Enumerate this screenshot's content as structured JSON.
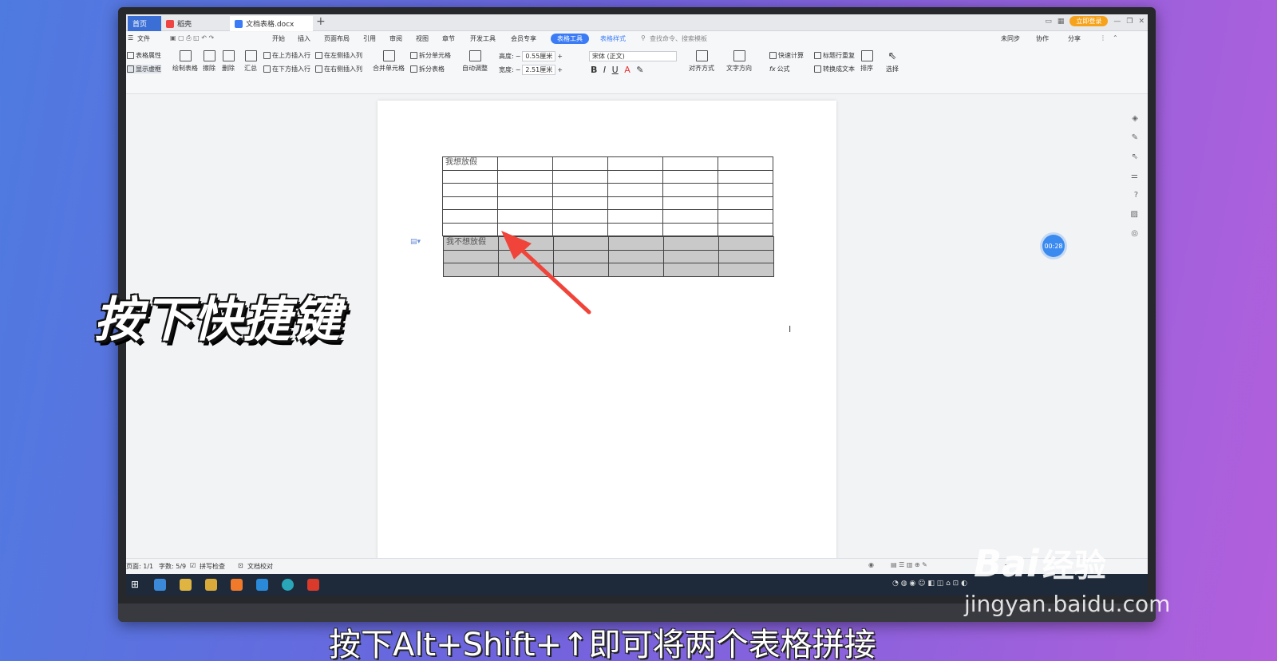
{
  "tabs": [
    {
      "label": "首页"
    },
    {
      "label": "稻壳"
    },
    {
      "label": "文档表格.docx"
    }
  ],
  "window": {
    "login_label": "立即登录",
    "new_tab": "+"
  },
  "menu": {
    "file": "文件",
    "items": [
      "开始",
      "插入",
      "页面布局",
      "引用",
      "审阅",
      "视图",
      "章节",
      "开发工具",
      "会员专享"
    ],
    "active": "表格工具",
    "table_style": "表格样式",
    "search": "查找命令、搜索模板",
    "sync": "未同步",
    "collab": "协作",
    "share": "分享"
  },
  "ribbon": {
    "table_props": "表格属性",
    "show_gridlines": "显示虚框",
    "draw_table": "绘制表格",
    "erase": "擦除",
    "delete": "删除",
    "summary": "汇总",
    "insert_above": "在上方插入行",
    "insert_below": "在下方插入行",
    "insert_left": "在左侧插入列",
    "insert_right": "在右侧插入列",
    "merge_cells": "合并单元格",
    "split_cells": "拆分单元格",
    "split_table": "拆分表格",
    "auto_fit": "自动调整",
    "height_label": "高度:",
    "height_value": "0.55厘米",
    "width_label": "宽度:",
    "width_value": "2.51厘米",
    "font": "宋体 (正文)",
    "align": "对齐方式",
    "text_dir": "文字方向",
    "quick_calc": "快速计算",
    "title_repeat": "标题行重复",
    "formula": "公式",
    "to_text": "转换成文本",
    "sort": "排序",
    "select": "选择"
  },
  "document": {
    "table1_first_cell": "我想放假",
    "table2_first_cell": "我不想放假"
  },
  "timer": "00:28",
  "status": {
    "page": "页面: 1/1",
    "words": "字数: 5/9",
    "spell": "拼写检查",
    "proof": "文档校对"
  },
  "overlay": {
    "headline": "按下快捷键",
    "subtitle": "按下Alt+Shift+↑即可将两个表格拼接"
  },
  "watermark": {
    "brand": "Bai",
    "brand2": "经验",
    "url": "jingyan.baidu.com"
  },
  "colors": {
    "accent": "#3b7cf6",
    "arrow": "#f0443a",
    "login": "#f7a21b"
  }
}
